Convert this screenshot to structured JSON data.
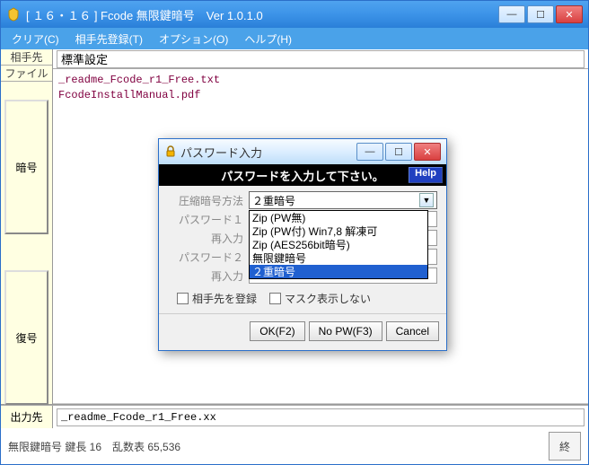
{
  "main": {
    "title": "[ １６・１６ ] Fcode 無限鍵暗号　Ver 1.0.1.0",
    "menu": {
      "clear": "クリア(C)",
      "register": "相手先登録(T)",
      "options": "オプション(O)",
      "help": "ヘルプ(H)"
    },
    "side": {
      "dest": "相手先",
      "file": "ファイル",
      "encrypt": "暗号",
      "decrypt": "復号",
      "output": "出力先"
    },
    "dest_select": "標準設定",
    "files": [
      "_readme_Fcode_r1_Free.txt",
      "FcodeInstallManual.pdf"
    ],
    "output_file": "_readme_Fcode_r1_Free.xx",
    "status": "無限鍵暗号 鍵長 16　乱数表 65,536",
    "end_btn": "終"
  },
  "dialog": {
    "title": "パスワード入力",
    "prompt": "パスワードを入力して下さい。",
    "help": "Help",
    "labels": {
      "method": "圧縮暗号方法",
      "pw1": "パスワード１",
      "pw1r": "再入力",
      "pw2": "パスワード２",
      "pw2r": "再入力"
    },
    "method_value": "２重暗号",
    "options": [
      "Zip (PW無)",
      "Zip (PW付)  Win7,8 解凍可",
      "Zip (AES256bit暗号)",
      "無限鍵暗号",
      "２重暗号"
    ],
    "check1": "相手先を登録",
    "check2": "マスク表示しない",
    "btn_ok": "OK(F2)",
    "btn_nopw": "No PW(F3)",
    "btn_cancel": "Cancel"
  }
}
